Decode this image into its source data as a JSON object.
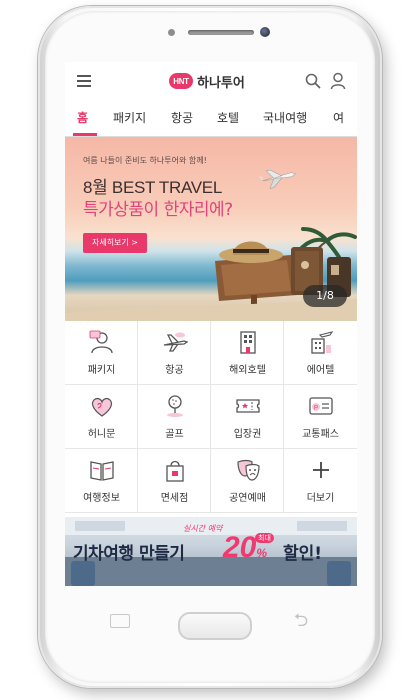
{
  "header": {
    "logo_badge": "HNT",
    "logo_text": "하나투어"
  },
  "tabs": [
    {
      "label": "홈",
      "active": true
    },
    {
      "label": "패키지"
    },
    {
      "label": "항공"
    },
    {
      "label": "호텔"
    },
    {
      "label": "국내여행"
    },
    {
      "label": "여"
    }
  ],
  "banner": {
    "subtitle": "여름 나들이 준비도 하나투어와 함께!",
    "title": "8월 BEST TRAVEL",
    "headline": "특가상품이 한자리에?",
    "button_label": "자세히보기 >",
    "counter": "1/8"
  },
  "menu": [
    {
      "label": "패키지",
      "icon": "package-person-icon"
    },
    {
      "label": "항공",
      "icon": "airplane-icon"
    },
    {
      "label": "해외호텔",
      "icon": "hotel-building-icon"
    },
    {
      "label": "에어텔",
      "icon": "airtel-icon"
    },
    {
      "label": "허니문",
      "icon": "heart-icon"
    },
    {
      "label": "골프",
      "icon": "golf-icon"
    },
    {
      "label": "입장권",
      "icon": "ticket-icon"
    },
    {
      "label": "교통패스",
      "icon": "transport-pass-icon"
    },
    {
      "label": "여행정보",
      "icon": "book-icon"
    },
    {
      "label": "면세점",
      "icon": "shopping-bag-icon"
    },
    {
      "label": "공연예매",
      "icon": "theater-mask-icon"
    },
    {
      "label": "더보기",
      "icon": "plus-icon"
    }
  ],
  "promo": {
    "subtitle": "실시간 예약",
    "main": "기차여행 만들기",
    "percent": "20",
    "percent_unit": "%",
    "tag": "최대",
    "tail": "할인!"
  },
  "colors": {
    "accent": "#e8396a",
    "promo_pink": "#f0396f",
    "text_dark": "#333333"
  }
}
